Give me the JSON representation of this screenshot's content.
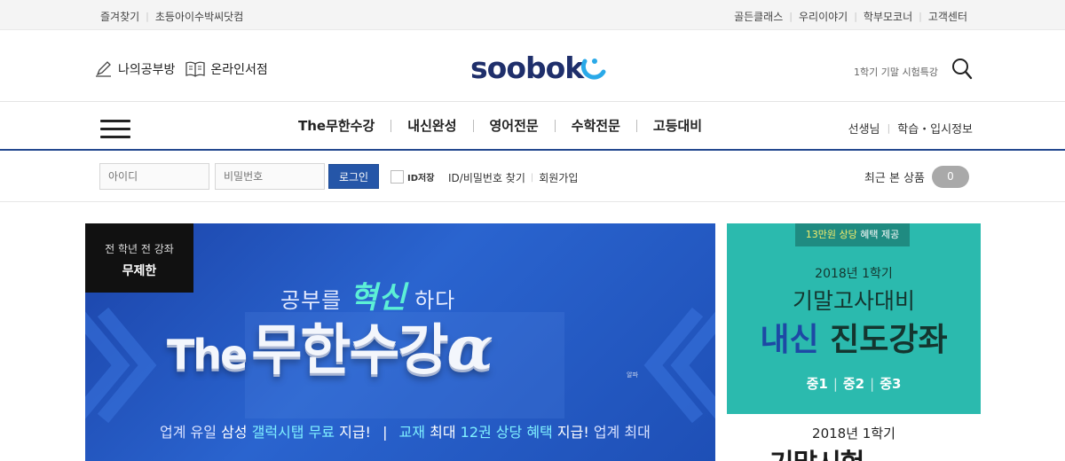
{
  "util_bar": {
    "left_links": [
      "즐겨찾기",
      "초등아이수박씨닷컴"
    ],
    "right_links": [
      "골든클래스",
      "우리이야기",
      "학부모코너",
      "고객센터"
    ]
  },
  "header": {
    "study_room": "나의공부방",
    "bookstore": "온라인서점",
    "logo_text": "soobok",
    "promo_text": "1학기 기말 시험특강"
  },
  "nav": {
    "items": [
      "The무한수강",
      "내신완성",
      "영어전문",
      "수학전문",
      "고등대비"
    ],
    "side_links": [
      "선생님",
      "학습・입시정보"
    ]
  },
  "login": {
    "id_placeholder": "아이디",
    "pw_placeholder": "비밀번호",
    "login_button": "로그인",
    "save_id_label": "ID저장",
    "find_link": "ID/비밀번호 찾기",
    "join_link": "회원가입",
    "recent_label": "최근 본 상품",
    "recent_count": "0"
  },
  "hero": {
    "tag_line1": "전 학년 전 강좌",
    "tag_line2": "무제한",
    "subtitle_pre": "공부를",
    "subtitle_highlight": "혁신",
    "subtitle_post": "하다",
    "title_the": "The",
    "title_main": "무한수강",
    "title_alpha": "α",
    "alpha_small": "알파",
    "bottom_1": "업계 유일",
    "bottom_2": "삼성",
    "bottom_3": "갤럭시탭 무료",
    "bottom_4": "지급!",
    "bottom_5": "교재",
    "bottom_6": "최대",
    "bottom_7": "12권 상당 혜택",
    "bottom_8": "지급!",
    "bottom_9": "업계 최대"
  },
  "side_banner": {
    "pill_amount": "13만원 상당",
    "pill_rest": "혜택 제공",
    "line1": "2018년 1학기",
    "line2": "기말고사대비",
    "line3_accent": "내신",
    "line3_rest": "진도강좌",
    "grades": [
      "중1",
      "중2",
      "중3"
    ],
    "bottom_year": "2018년 1학기",
    "bottom_title": "기말시험"
  },
  "colors": {
    "nav_underline": "#23488f",
    "login_button": "#2556a8",
    "logo_navy": "#1f2f6b",
    "logo_drop": "#2aa9e8",
    "side_banner_teal": "#2bbaae",
    "hero_blue": "#2a64cf"
  }
}
